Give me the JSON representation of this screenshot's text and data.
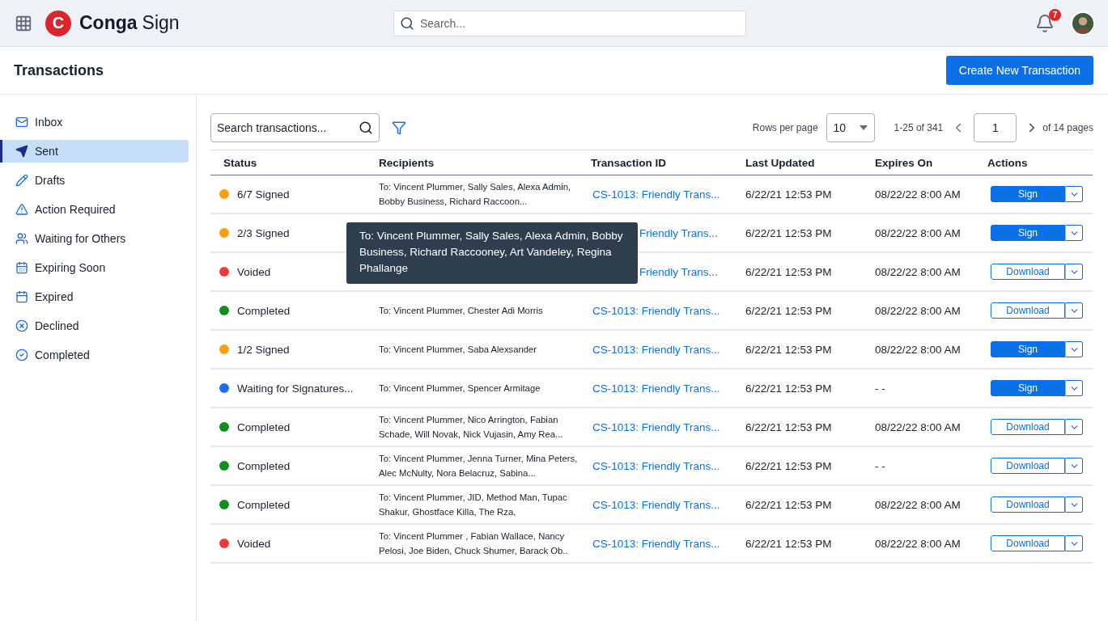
{
  "topbar": {
    "brand_mark": "C",
    "brand_name": "Conga",
    "brand_product": "Sign",
    "search": {
      "placeholder": "Search..."
    },
    "notifications": "7"
  },
  "page": {
    "title": "Transactions",
    "create_button": "Create New Transaction"
  },
  "sidebar": {
    "items": [
      {
        "label": "Inbox",
        "selected": false
      },
      {
        "label": "Sent",
        "selected": true
      },
      {
        "label": "Drafts",
        "selected": false
      },
      {
        "label": "Action Required",
        "selected": false
      },
      {
        "label": "Waiting for Others",
        "selected": false
      },
      {
        "label": "Expiring Soon",
        "selected": false
      },
      {
        "label": "Expired",
        "selected": false
      },
      {
        "label": "Declined",
        "selected": false
      },
      {
        "label": "Completed",
        "selected": false
      }
    ]
  },
  "toolbar": {
    "search": {
      "placeholder": "Search transactions..."
    },
    "rows_per_page_label": "Rows per page",
    "rows_per_page": "10",
    "range": "1-25 of 341",
    "page": "1",
    "pages": "of 14 pages"
  },
  "table": {
    "columns": [
      "Status",
      "Recipients",
      "Transaction ID",
      "Last Updated",
      "Expires On",
      "Actions"
    ],
    "rows": [
      {
        "status": "6/7 Signed",
        "color": "#f5a00f",
        "recipients": "To: Vincent Plummer, Sally Sales, Alexa Admin, Bobby Business, Richard Raccoon...",
        "transaction_id": "CS-1013: Friendly Trans...",
        "last_updated": "6/22/21 12:53 PM",
        "expires_on": "08/22/22 8:00 AM",
        "action": {
          "label": "Sign",
          "kind": "primary"
        }
      },
      {
        "status": "2/3 Signed",
        "color": "#f5a00f",
        "transaction_id": "Friendly Trans...",
        "last_updated": "6/22/21 12:53 PM",
        "expires_on": "08/22/22 8:00 AM",
        "action": {
          "label": "Sign",
          "kind": "primary"
        }
      },
      {
        "status": "Voided",
        "color": "#f03a3a",
        "transaction_id": "Friendly Trans...",
        "last_updated": "6/22/21 12:53 PM",
        "expires_on": "08/22/22 8:00 AM",
        "action": {
          "label": "Download",
          "kind": "outline"
        }
      },
      {
        "status": "Completed",
        "color": "#118c1e",
        "recipients": "To: Vincent Plummer,  Chester Adi Morris",
        "transaction_id": "CS-1013: Friendly Trans...",
        "last_updated": "6/22/21 12:53 PM",
        "expires_on": "08/22/22 8:00 AM",
        "action": {
          "label": "Download",
          "kind": "outline"
        }
      },
      {
        "status": "1/2 Signed",
        "color": "#f5a00f",
        "recipients": "To: Vincent Plummer, Saba Alexsander",
        "transaction_id": "CS-1013: Friendly Trans...",
        "last_updated": "6/22/21 12:53 PM",
        "expires_on": "08/22/22 8:00 AM",
        "action": {
          "label": "Sign",
          "kind": "primary"
        }
      },
      {
        "status": "Waiting for Signatures...",
        "color": "#1a6cf0",
        "recipients": "To: Vincent Plummer, Spencer Armitage",
        "transaction_id": "CS-1013: Friendly Trans...",
        "last_updated": "6/22/21 12:53 PM",
        "expires_on": "- -",
        "action": {
          "label": "Sign",
          "kind": "primary"
        }
      },
      {
        "status": "Completed",
        "color": "#118c1e",
        "recipients": "To: Vincent Plummer, Nico Arrington, Fabian Schade, Will Novak, Nick Vujasin, Amy Rea...",
        "transaction_id": "CS-1013: Friendly Trans...",
        "last_updated": "6/22/21 12:53 PM",
        "expires_on": "08/22/22 8:00 AM",
        "action": {
          "label": "Download",
          "kind": "outline"
        }
      },
      {
        "status": "Completed",
        "color": "#118c1e",
        "recipients": "To: Vincent Plummer, Jenna Turner, Mina Peters, Alec McNulty, Nora Belacruz, Sabina...",
        "transaction_id": "CS-1013: Friendly Trans...",
        "last_updated": "6/22/21 12:53 PM",
        "expires_on": "- -",
        "action": {
          "label": "Download",
          "kind": "outline"
        }
      },
      {
        "status": "Completed",
        "color": "#118c1e",
        "recipients": "To: Vincent Plummer, JID, Method Man, Tupac Shakur, Ghostface Killa, The Rza,",
        "transaction_id": "CS-1013: Friendly Trans...",
        "last_updated": "6/22/21 12:53 PM",
        "expires_on": "08/22/22 8:00 AM",
        "action": {
          "label": "Download",
          "kind": "outline"
        }
      },
      {
        "status": "Voided",
        "color": "#f03a3a",
        "recipients": "To: Vincent Plummer , Fabian Wallace, Nancy Pelosi, Joe Biden, Chuck Shumer, Barack Ob..",
        "transaction_id": "CS-1013: Friendly Trans...",
        "last_updated": "6/22/21 12:53 PM",
        "expires_on": "08/22/22 8:00 AM",
        "action": {
          "label": "Download",
          "kind": "outline"
        }
      }
    ]
  },
  "tooltip": "To: Vincent Plummer, Sally Sales, Alexa Admin, Bobby Business, Richard Raccooney, Art Vandeley, Regina Phallange"
}
